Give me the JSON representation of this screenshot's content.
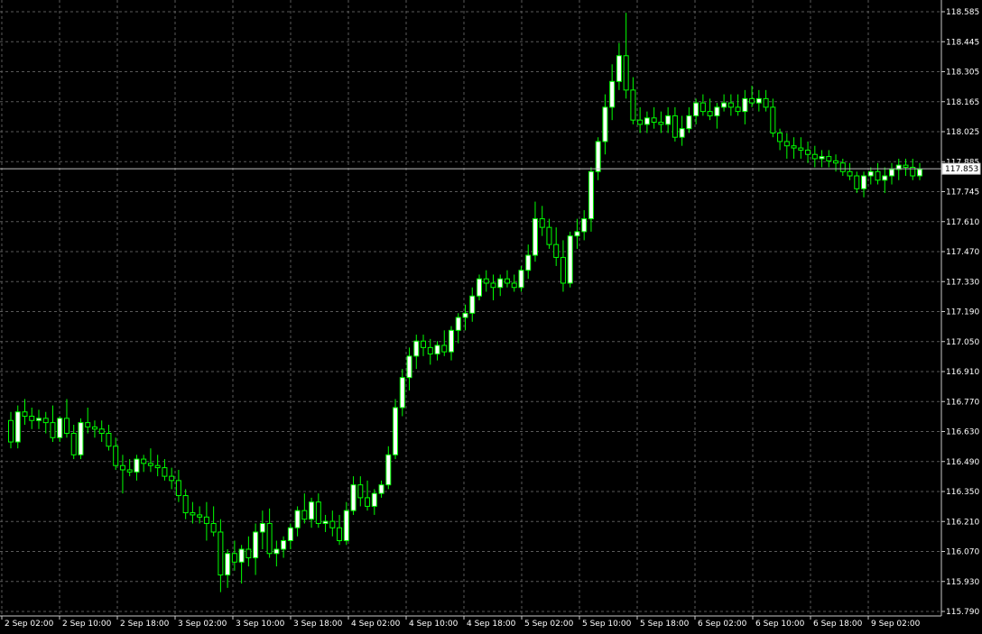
{
  "colors": {
    "background": "#000000",
    "grid": "#5a5a5a",
    "axis_text": "#ffffff",
    "bull_body": "#ffffff",
    "bear_body": "#000000",
    "candle_outline": "#00ff00",
    "wick": "#00ff00",
    "price_line": "#c0c0c0"
  },
  "chart_data": {
    "type": "candlestick",
    "title": "",
    "xlabel": "",
    "ylabel": "",
    "grid": true,
    "ylim": [
      115.72,
      118.62
    ],
    "y_ticks": [
      "118.585",
      "118.445",
      "118.305",
      "118.165",
      "118.025",
      "117.885",
      "117.745",
      "117.610",
      "117.470",
      "117.330",
      "117.190",
      "117.050",
      "116.910",
      "116.770",
      "116.630",
      "116.490",
      "116.350",
      "116.210",
      "116.070",
      "115.930",
      "115.790"
    ],
    "x_ticks": [
      "2 Sep 02:00",
      "2 Sep 10:00",
      "2 Sep 18:00",
      "3 Sep 02:00",
      "3 Sep 10:00",
      "3 Sep 18:00",
      "4 Sep 02:00",
      "4 Sep 10:00",
      "4 Sep 18:00",
      "5 Sep 02:00",
      "5 Sep 10:00",
      "5 Sep 18:00",
      "6 Sep 02:00",
      "6 Sep 10:00",
      "6 Sep 18:00",
      "9 Sep 02:00"
    ],
    "current_price": "117.853",
    "candles": [
      [
        116.68,
        116.72,
        116.55,
        116.58
      ],
      [
        116.58,
        116.75,
        116.55,
        116.72
      ],
      [
        116.72,
        116.78,
        116.66,
        116.7
      ],
      [
        116.7,
        116.74,
        116.64,
        116.68
      ],
      [
        116.68,
        116.73,
        116.64,
        116.69
      ],
      [
        116.69,
        116.72,
        116.62,
        116.67
      ],
      [
        116.67,
        116.75,
        116.58,
        116.6
      ],
      [
        116.6,
        116.7,
        116.58,
        116.69
      ],
      [
        116.69,
        116.78,
        116.6,
        116.62
      ],
      [
        116.62,
        116.66,
        116.5,
        116.52
      ],
      [
        116.52,
        116.69,
        116.5,
        116.67
      ],
      [
        116.67,
        116.74,
        116.62,
        116.65
      ],
      [
        116.65,
        116.68,
        116.6,
        116.64
      ],
      [
        116.64,
        116.68,
        116.58,
        116.62
      ],
      [
        116.62,
        116.66,
        116.54,
        116.56
      ],
      [
        116.56,
        116.6,
        116.45,
        116.47
      ],
      [
        116.47,
        116.52,
        116.34,
        116.45
      ],
      [
        116.45,
        116.5,
        116.42,
        116.44
      ],
      [
        116.44,
        116.52,
        116.4,
        116.5
      ],
      [
        116.5,
        116.52,
        116.44,
        116.48
      ],
      [
        116.48,
        116.55,
        116.44,
        116.47
      ],
      [
        116.47,
        116.52,
        116.42,
        116.46
      ],
      [
        116.46,
        116.5,
        116.4,
        116.42
      ],
      [
        116.42,
        116.46,
        116.36,
        116.4
      ],
      [
        116.4,
        116.45,
        116.3,
        116.33
      ],
      [
        116.33,
        116.36,
        116.22,
        116.25
      ],
      [
        116.25,
        116.3,
        116.2,
        116.24
      ],
      [
        116.24,
        116.28,
        116.2,
        116.23
      ],
      [
        116.23,
        116.3,
        116.12,
        116.2
      ],
      [
        116.2,
        116.28,
        116.14,
        116.16
      ],
      [
        116.16,
        116.22,
        115.88,
        115.96
      ],
      [
        115.96,
        116.08,
        115.9,
        116.06
      ],
      [
        116.06,
        116.12,
        115.98,
        116.02
      ],
      [
        116.02,
        116.1,
        115.92,
        116.08
      ],
      [
        116.08,
        116.14,
        116.0,
        116.04
      ],
      [
        116.04,
        116.2,
        115.96,
        116.16
      ],
      [
        116.16,
        116.26,
        116.08,
        116.2
      ],
      [
        116.2,
        116.27,
        116.04,
        116.06
      ],
      [
        116.06,
        116.12,
        116.0,
        116.08
      ],
      [
        116.08,
        116.14,
        116.04,
        116.12
      ],
      [
        116.12,
        116.2,
        116.08,
        116.18
      ],
      [
        116.18,
        116.28,
        116.14,
        116.26
      ],
      [
        116.26,
        116.34,
        116.2,
        116.22
      ],
      [
        116.22,
        116.32,
        116.18,
        116.3
      ],
      [
        116.3,
        116.34,
        116.18,
        116.2
      ],
      [
        116.2,
        116.24,
        116.16,
        116.21
      ],
      [
        116.21,
        116.26,
        116.14,
        116.18
      ],
      [
        116.18,
        116.24,
        116.1,
        116.12
      ],
      [
        116.12,
        116.3,
        116.1,
        116.26
      ],
      [
        116.26,
        116.42,
        116.24,
        116.38
      ],
      [
        116.38,
        116.42,
        116.28,
        116.32
      ],
      [
        116.32,
        116.4,
        116.26,
        116.28
      ],
      [
        116.28,
        116.36,
        116.24,
        116.34
      ],
      [
        116.34,
        116.4,
        116.32,
        116.38
      ],
      [
        116.38,
        116.56,
        116.36,
        116.52
      ],
      [
        116.52,
        116.78,
        116.5,
        116.74
      ],
      [
        116.74,
        116.92,
        116.7,
        116.88
      ],
      [
        116.88,
        117.02,
        116.82,
        116.98
      ],
      [
        116.98,
        117.08,
        116.92,
        117.05
      ],
      [
        117.05,
        117.08,
        116.98,
        117.02
      ],
      [
        117.02,
        117.06,
        116.94,
        116.99
      ],
      [
        116.99,
        117.05,
        116.96,
        117.03
      ],
      [
        117.03,
        117.1,
        116.98,
        117.0
      ],
      [
        117.0,
        117.12,
        116.96,
        117.1
      ],
      [
        117.1,
        117.18,
        117.04,
        117.16
      ],
      [
        117.16,
        117.22,
        117.1,
        117.18
      ],
      [
        117.18,
        117.3,
        117.14,
        117.26
      ],
      [
        117.26,
        117.36,
        117.24,
        117.34
      ],
      [
        117.34,
        117.38,
        117.28,
        117.32
      ],
      [
        117.32,
        117.36,
        117.24,
        117.3
      ],
      [
        117.3,
        117.36,
        117.26,
        117.34
      ],
      [
        117.34,
        117.38,
        117.3,
        117.32
      ],
      [
        117.32,
        117.36,
        117.28,
        117.3
      ],
      [
        117.3,
        117.4,
        117.28,
        117.38
      ],
      [
        117.38,
        117.5,
        117.34,
        117.45
      ],
      [
        117.45,
        117.7,
        117.42,
        117.62
      ],
      [
        117.62,
        117.68,
        117.54,
        117.58
      ],
      [
        117.58,
        117.62,
        117.48,
        117.5
      ],
      [
        117.5,
        117.58,
        117.4,
        117.44
      ],
      [
        117.44,
        117.52,
        117.28,
        117.32
      ],
      [
        117.32,
        117.56,
        117.3,
        117.54
      ],
      [
        117.54,
        117.62,
        117.48,
        117.56
      ],
      [
        117.56,
        117.66,
        117.52,
        117.62
      ],
      [
        117.62,
        117.86,
        117.56,
        117.84
      ],
      [
        117.84,
        118.0,
        117.8,
        117.98
      ],
      [
        117.98,
        118.2,
        117.92,
        118.14
      ],
      [
        118.14,
        118.34,
        118.08,
        118.26
      ],
      [
        118.26,
        118.44,
        118.22,
        118.38
      ],
      [
        118.38,
        118.58,
        118.18,
        118.22
      ],
      [
        118.22,
        118.28,
        118.06,
        118.08
      ],
      [
        118.08,
        118.14,
        118.02,
        118.06
      ],
      [
        118.06,
        118.12,
        118.02,
        118.09
      ],
      [
        118.09,
        118.14,
        118.04,
        118.07
      ],
      [
        118.07,
        118.12,
        118.02,
        118.06
      ],
      [
        118.06,
        118.14,
        118.02,
        118.1
      ],
      [
        118.1,
        118.14,
        117.98,
        118.0
      ],
      [
        118.0,
        118.1,
        117.96,
        118.04
      ],
      [
        118.04,
        118.14,
        118.02,
        118.1
      ],
      [
        118.1,
        118.18,
        118.06,
        118.16
      ],
      [
        118.16,
        118.2,
        118.1,
        118.12
      ],
      [
        118.12,
        118.18,
        118.08,
        118.1
      ],
      [
        118.1,
        118.16,
        118.04,
        118.14
      ],
      [
        118.14,
        118.2,
        118.12,
        118.16
      ],
      [
        118.16,
        118.2,
        118.1,
        118.14
      ],
      [
        118.14,
        118.2,
        118.1,
        118.12
      ],
      [
        118.12,
        118.22,
        118.06,
        118.18
      ],
      [
        118.18,
        118.24,
        118.14,
        118.16
      ],
      [
        118.16,
        118.22,
        118.12,
        118.18
      ],
      [
        118.18,
        118.22,
        118.12,
        118.14
      ],
      [
        118.14,
        118.18,
        118.0,
        118.02
      ],
      [
        118.02,
        118.04,
        117.94,
        117.98
      ],
      [
        117.98,
        118.02,
        117.9,
        117.96
      ],
      [
        117.96,
        118.0,
        117.9,
        117.95
      ],
      [
        117.95,
        118.0,
        117.9,
        117.94
      ],
      [
        117.94,
        117.98,
        117.88,
        117.92
      ],
      [
        117.92,
        117.96,
        117.86,
        117.9
      ],
      [
        117.9,
        117.94,
        117.86,
        117.91
      ],
      [
        117.91,
        117.94,
        117.86,
        117.89
      ],
      [
        117.89,
        117.92,
        117.84,
        117.88
      ],
      [
        117.88,
        117.9,
        117.82,
        117.84
      ],
      [
        117.84,
        117.88,
        117.8,
        117.82
      ],
      [
        117.82,
        117.84,
        117.74,
        117.76
      ],
      [
        117.76,
        117.84,
        117.72,
        117.82
      ],
      [
        117.82,
        117.86,
        117.78,
        117.84
      ],
      [
        117.84,
        117.88,
        117.78,
        117.8
      ],
      [
        117.8,
        117.86,
        117.74,
        117.82
      ],
      [
        117.82,
        117.88,
        117.78,
        117.85
      ],
      [
        117.85,
        117.9,
        117.8,
        117.87
      ],
      [
        117.87,
        117.9,
        117.82,
        117.86
      ],
      [
        117.86,
        117.9,
        117.8,
        117.82
      ],
      [
        117.82,
        117.88,
        117.8,
        117.85
      ]
    ]
  }
}
